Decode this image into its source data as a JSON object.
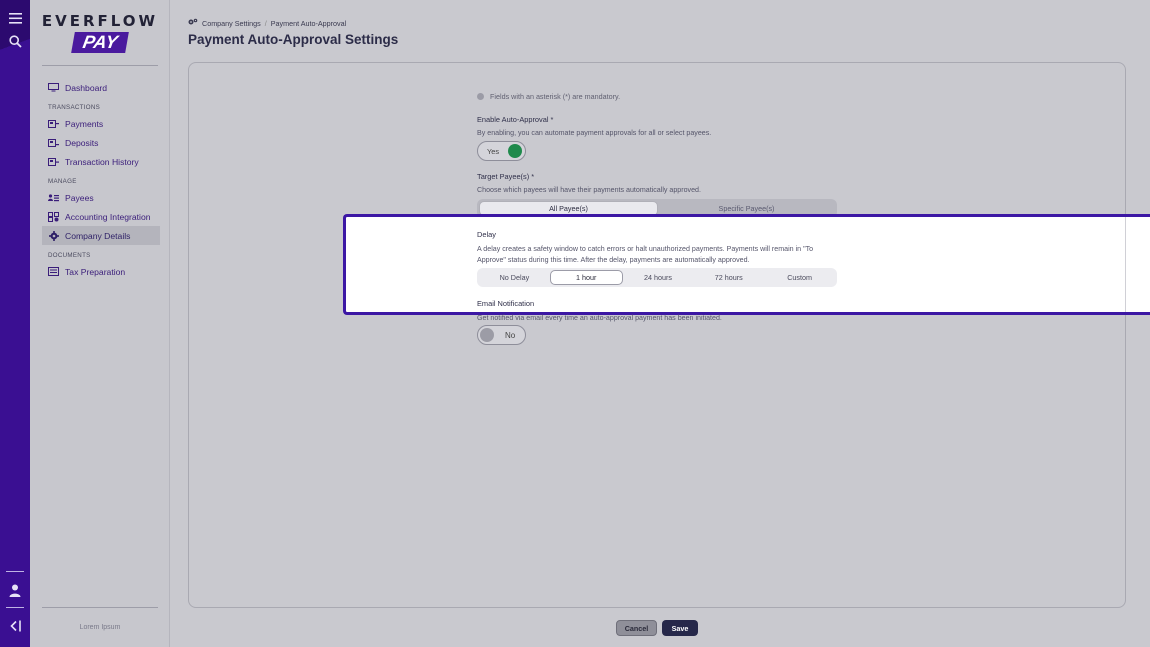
{
  "brand": {
    "word": "EVERFLOW",
    "sub": "PAY"
  },
  "rail": {
    "icons": [
      "menu-icon",
      "search-icon",
      "user-icon",
      "collapse-icon"
    ]
  },
  "nav": {
    "dashboard": "Dashboard",
    "sections": {
      "transactions": "TRANSACTIONS",
      "manage": "MANAGE",
      "documents": "DOCUMENTS"
    },
    "payments": "Payments",
    "deposits": "Deposits",
    "history": "Transaction History",
    "payees": "Payees",
    "accounting": "Accounting Integration",
    "company": "Company Details",
    "tax": "Tax Preparation",
    "footer": "Lorem Ipsum"
  },
  "breadcrumb": {
    "parent": "Company Settings",
    "separator": "/",
    "current": "Payment Auto-Approval"
  },
  "page": {
    "title": "Payment Auto-Approval Settings"
  },
  "form": {
    "mandatory_note": "Fields with an asterisk (*) are mandatory.",
    "enable": {
      "label": "Enable Auto-Approval *",
      "help": "By enabling, you can automate payment approvals for all or select payees.",
      "value": "Yes"
    },
    "target": {
      "label": "Target Payee(s) *",
      "help": "Choose which payees will have their payments automatically approved.",
      "options": [
        "All Payee(s)",
        "Specific Payee(s)"
      ],
      "selected": "All Payee(s)"
    },
    "delay": {
      "label": "Delay",
      "help_line1": "A delay creates a safety window to catch errors or halt unauthorized payments. Payments will remain in \"To",
      "help_line2": "Approve\" status during this time. After the delay, payments are automatically approved.",
      "options": [
        "No Delay",
        "1 hour",
        "24 hours",
        "72 hours",
        "Custom"
      ],
      "selected": "1 hour"
    },
    "email": {
      "label": "Email Notification",
      "help": "Get notified via email every time an auto-approval payment has been initiated.",
      "value": "No"
    }
  },
  "actions": {
    "cancel": "Cancel",
    "save": "Save"
  },
  "colors": {
    "accent": "#3a0f92",
    "toggle_on": "#1f8a4c",
    "highlight_border": "#3c17a4",
    "save": "#26284a"
  }
}
